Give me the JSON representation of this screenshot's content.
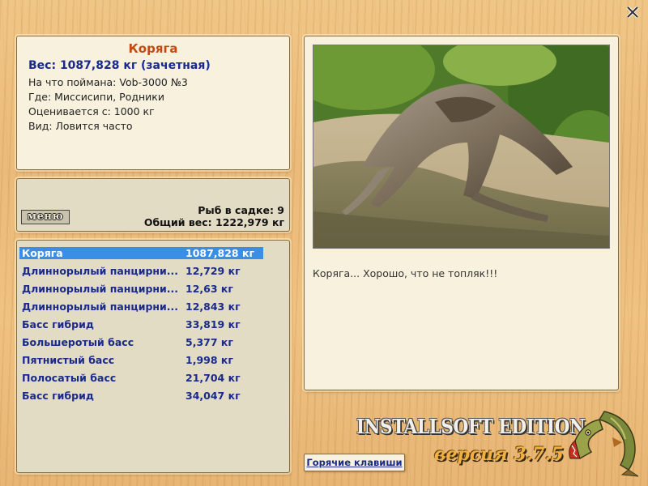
{
  "window": {
    "close_label": "✕"
  },
  "info": {
    "title": "Коряга",
    "weight": "Вес: 1087,828 кг (зачетная)",
    "lines": [
      "На что поймана: Vob-3000 №3",
      "Где: Миссисипи, Родники",
      "Оценивается с: 1000 кг",
      "Вид: Ловится часто"
    ]
  },
  "menu": {
    "label": "меню"
  },
  "stats": {
    "count": "Рыб в садке: 9",
    "total": "Общий вес: 1222,979 кг"
  },
  "catch_list": [
    {
      "name": "Коряга",
      "weight": "1087,828 кг",
      "selected": true
    },
    {
      "name": "Длиннорылый панцирни...",
      "weight": "12,729 кг"
    },
    {
      "name": "Длиннорылый панцирни...",
      "weight": "12,63 кг"
    },
    {
      "name": "Длиннорылый панцирни...",
      "weight": "12,843 кг"
    },
    {
      "name": "Басс гибрид",
      "weight": "33,819 кг"
    },
    {
      "name": "Большеротый басс",
      "weight": "5,377 кг"
    },
    {
      "name": "Пятнистый басс",
      "weight": "1,998 кг"
    },
    {
      "name": "Полосатый басс",
      "weight": "21,704 кг"
    },
    {
      "name": "Басс гибрид",
      "weight": "34,047 кг"
    }
  ],
  "photo": {
    "caption": "Коряга... Хорошо, что не топляк!!!"
  },
  "hotkeys": {
    "label": "Горячие клавиши"
  },
  "branding": {
    "edition": "INSTALLSOFT EDITION",
    "version": "версия 3.7.5"
  },
  "colors": {
    "selection": "#3a8ee6",
    "title": "#c24a10",
    "text_blue": "#1a2a8c"
  }
}
